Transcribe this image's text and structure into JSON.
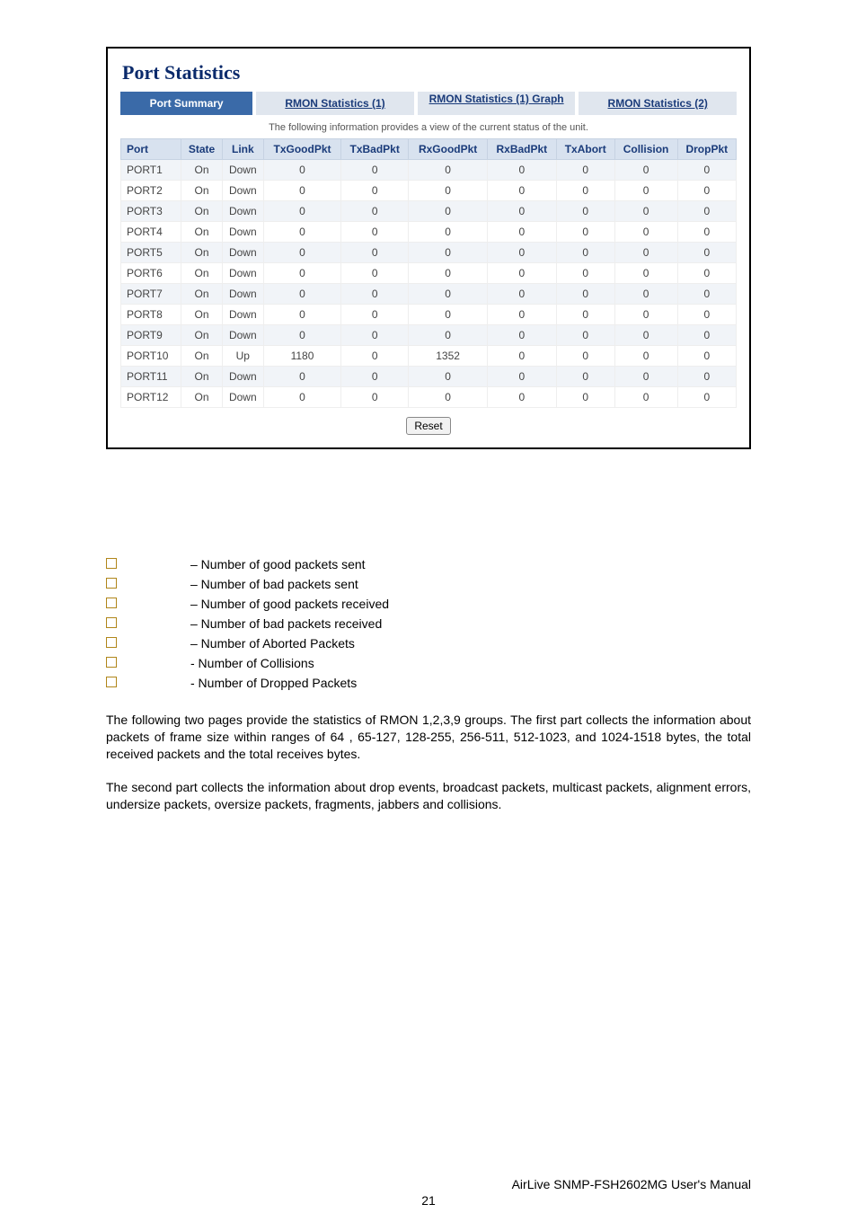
{
  "panel": {
    "title": "Port Statistics",
    "tabs": [
      {
        "label": "Port Summary",
        "active": true
      },
      {
        "label": "RMON Statistics (1)",
        "active": false
      },
      {
        "label": "RMON Statistics (1) Graph",
        "active": false
      },
      {
        "label": "RMON Statistics (2)",
        "active": false
      }
    ],
    "caption": "The following information provides a view of the current status of the unit.",
    "columns": [
      "Port",
      "State",
      "Link",
      "TxGoodPkt",
      "TxBadPkt",
      "RxGoodPkt",
      "RxBadPkt",
      "TxAbort",
      "Collision",
      "DropPkt"
    ],
    "rows": [
      {
        "port": "PORT1",
        "state": "On",
        "link": "Down",
        "txg": "0",
        "txb": "0",
        "rxg": "0",
        "rxb": "0",
        "txa": "0",
        "col": "0",
        "drp": "0"
      },
      {
        "port": "PORT2",
        "state": "On",
        "link": "Down",
        "txg": "0",
        "txb": "0",
        "rxg": "0",
        "rxb": "0",
        "txa": "0",
        "col": "0",
        "drp": "0"
      },
      {
        "port": "PORT3",
        "state": "On",
        "link": "Down",
        "txg": "0",
        "txb": "0",
        "rxg": "0",
        "rxb": "0",
        "txa": "0",
        "col": "0",
        "drp": "0"
      },
      {
        "port": "PORT4",
        "state": "On",
        "link": "Down",
        "txg": "0",
        "txb": "0",
        "rxg": "0",
        "rxb": "0",
        "txa": "0",
        "col": "0",
        "drp": "0"
      },
      {
        "port": "PORT5",
        "state": "On",
        "link": "Down",
        "txg": "0",
        "txb": "0",
        "rxg": "0",
        "rxb": "0",
        "txa": "0",
        "col": "0",
        "drp": "0"
      },
      {
        "port": "PORT6",
        "state": "On",
        "link": "Down",
        "txg": "0",
        "txb": "0",
        "rxg": "0",
        "rxb": "0",
        "txa": "0",
        "col": "0",
        "drp": "0"
      },
      {
        "port": "PORT7",
        "state": "On",
        "link": "Down",
        "txg": "0",
        "txb": "0",
        "rxg": "0",
        "rxb": "0",
        "txa": "0",
        "col": "0",
        "drp": "0"
      },
      {
        "port": "PORT8",
        "state": "On",
        "link": "Down",
        "txg": "0",
        "txb": "0",
        "rxg": "0",
        "rxb": "0",
        "txa": "0",
        "col": "0",
        "drp": "0"
      },
      {
        "port": "PORT9",
        "state": "On",
        "link": "Down",
        "txg": "0",
        "txb": "0",
        "rxg": "0",
        "rxb": "0",
        "txa": "0",
        "col": "0",
        "drp": "0"
      },
      {
        "port": "PORT10",
        "state": "On",
        "link": "Up",
        "txg": "1180",
        "txb": "0",
        "rxg": "1352",
        "rxb": "0",
        "txa": "0",
        "col": "0",
        "drp": "0"
      },
      {
        "port": "PORT11",
        "state": "On",
        "link": "Down",
        "txg": "0",
        "txb": "0",
        "rxg": "0",
        "rxb": "0",
        "txa": "0",
        "col": "0",
        "drp": "0"
      },
      {
        "port": "PORT12",
        "state": "On",
        "link": "Down",
        "txg": "0",
        "txb": "0",
        "rxg": "0",
        "rxb": "0",
        "txa": "0",
        "col": "0",
        "drp": "0"
      }
    ],
    "reset_label": "Reset"
  },
  "bullets": [
    "– Number of good packets sent",
    "– Number of bad packets sent",
    "– Number of good packets received",
    "– Number of bad packets received",
    "–  Number of Aborted Packets",
    "- Number of Collisions",
    "- Number of Dropped Packets"
  ],
  "paras": [
    "The following two pages provide the statistics of RMON 1,2,3,9 groups. The first part collects the information about packets of frame size within ranges of 64 , 65-127, 128-255, 256-511, 512-1023, and 1024-1518 bytes, the total received packets and the total receives bytes.",
    "The second part collects the information about drop events, broadcast packets, multicast packets, alignment errors, undersize packets, oversize packets, fragments, jabbers and collisions."
  ],
  "footer": {
    "manual": "AirLive SNMP-FSH2602MG User's Manual",
    "page": "21"
  }
}
